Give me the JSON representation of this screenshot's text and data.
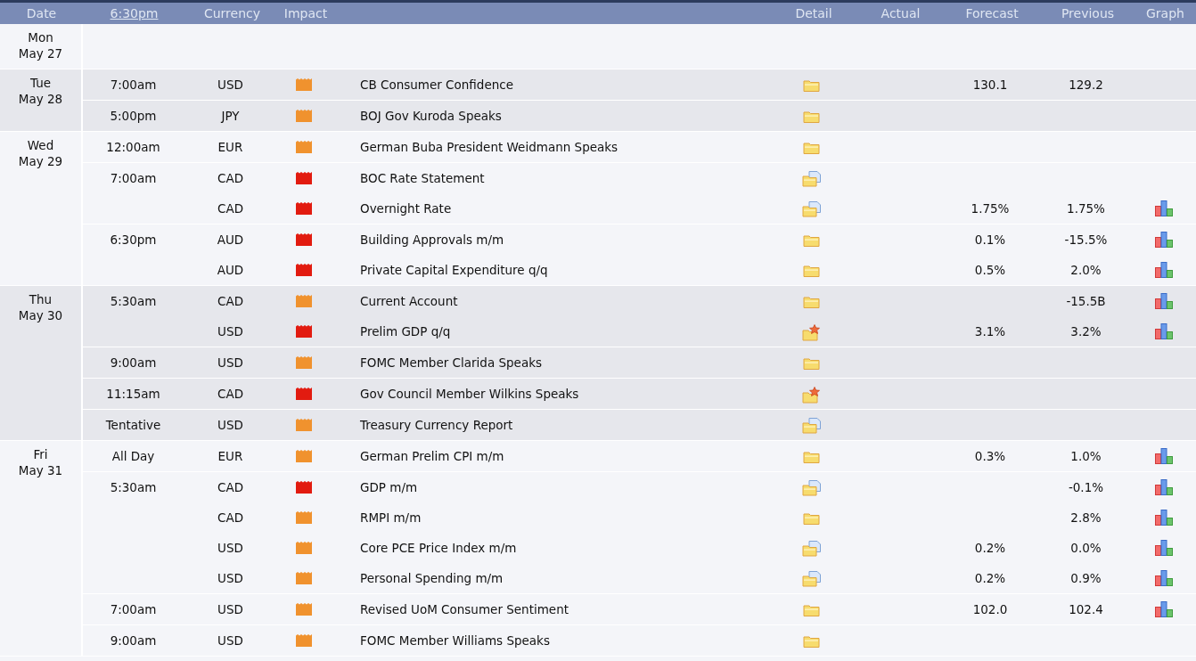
{
  "header": {
    "date": "Date",
    "time": "6:30pm",
    "currency": "Currency",
    "impact": "Impact",
    "detail": "Detail",
    "actual": "Actual",
    "forecast": "Forecast",
    "previous": "Previous",
    "graph": "Graph"
  },
  "days": [
    {
      "day": "Mon",
      "date": "May 27"
    },
    {
      "day": "Tue",
      "date": "May 28",
      "groups": [
        {
          "time": "7:00am",
          "events": [
            {
              "currency": "USD",
              "impact": {
                "color": "#f0922e"
              },
              "title": "CB Consumer Confidence",
              "detail": {
                "kind": "folder"
              },
              "forecast": "130.1",
              "previous": "129.2",
              "graph": false
            }
          ]
        },
        {
          "time": "5:00pm",
          "events": [
            {
              "currency": "JPY",
              "impact": {
                "color": "#f0922e"
              },
              "title": "BOJ Gov Kuroda Speaks",
              "detail": {
                "kind": "folder"
              },
              "graph": false
            }
          ]
        }
      ]
    },
    {
      "day": "Wed",
      "date": "May 29",
      "groups": [
        {
          "time": "12:00am",
          "events": [
            {
              "currency": "EUR",
              "impact": {
                "color": "#f0922e"
              },
              "title": "German Buba President Weidmann Speaks",
              "detail": {
                "kind": "folder"
              },
              "graph": false
            }
          ]
        },
        {
          "time": "7:00am",
          "events": [
            {
              "currency": "CAD",
              "impact": {
                "color": "#e21b10"
              },
              "title": "BOC Rate Statement",
              "detail": {
                "kind": "document"
              },
              "graph": false
            },
            {
              "currency": "CAD",
              "impact": {
                "color": "#e21b10"
              },
              "title": "Overnight Rate",
              "detail": {
                "kind": "document"
              },
              "forecast": "1.75%",
              "previous": "1.75%",
              "graph": true
            }
          ]
        },
        {
          "time": "6:30pm",
          "events": [
            {
              "currency": "AUD",
              "impact": {
                "color": "#e21b10"
              },
              "title": "Building Approvals m/m",
              "detail": {
                "kind": "folder"
              },
              "forecast": "0.1%",
              "previous": "-15.5%",
              "graph": true
            },
            {
              "currency": "AUD",
              "impact": {
                "color": "#e21b10"
              },
              "title": "Private Capital Expenditure q/q",
              "detail": {
                "kind": "folder"
              },
              "forecast": "0.5%",
              "previous": "2.0%",
              "graph": true
            }
          ]
        }
      ]
    },
    {
      "day": "Thu",
      "date": "May 30",
      "groups": [
        {
          "time": "5:30am",
          "events": [
            {
              "currency": "CAD",
              "impact": {
                "color": "#f0922e"
              },
              "title": "Current Account",
              "detail": {
                "kind": "folder"
              },
              "previous": "-15.5B",
              "graph": true
            },
            {
              "currency": "USD",
              "impact": {
                "color": "#e21b10"
              },
              "title": "Prelim GDP q/q",
              "detail": {
                "kind": "star"
              },
              "forecast": "3.1%",
              "previous": "3.2%",
              "graph": true
            }
          ]
        },
        {
          "time": "9:00am",
          "events": [
            {
              "currency": "USD",
              "impact": {
                "color": "#f0922e"
              },
              "title": "FOMC Member Clarida Speaks",
              "detail": {
                "kind": "folder"
              },
              "graph": false
            }
          ]
        },
        {
          "time": "11:15am",
          "events": [
            {
              "currency": "CAD",
              "impact": {
                "color": "#e21b10"
              },
              "title": "Gov Council Member Wilkins Speaks",
              "detail": {
                "kind": "star"
              },
              "graph": false
            }
          ]
        },
        {
          "time": "Tentative",
          "events": [
            {
              "currency": "USD",
              "impact": {
                "color": "#f0922e"
              },
              "title": "Treasury Currency Report",
              "detail": {
                "kind": "document"
              },
              "graph": false
            }
          ]
        }
      ]
    },
    {
      "day": "Fri",
      "date": "May 31",
      "groups": [
        {
          "time": "All Day",
          "events": [
            {
              "currency": "EUR",
              "impact": {
                "color": "#f0922e"
              },
              "title": "German Prelim CPI m/m",
              "detail": {
                "kind": "folder"
              },
              "forecast": "0.3%",
              "previous": "1.0%",
              "graph": true
            }
          ]
        },
        {
          "time": "5:30am",
          "events": [
            {
              "currency": "CAD",
              "impact": {
                "color": "#e21b10"
              },
              "title": "GDP m/m",
              "detail": {
                "kind": "document"
              },
              "previous": "-0.1%",
              "graph": true
            },
            {
              "currency": "CAD",
              "impact": {
                "color": "#f0922e"
              },
              "title": "RMPI m/m",
              "detail": {
                "kind": "folder"
              },
              "previous": "2.8%",
              "graph": true
            },
            {
              "currency": "USD",
              "impact": {
                "color": "#f0922e"
              },
              "title": "Core PCE Price Index m/m",
              "detail": {
                "kind": "document"
              },
              "forecast": "0.2%",
              "previous": "0.0%",
              "graph": true
            },
            {
              "currency": "USD",
              "impact": {
                "color": "#f0922e"
              },
              "title": "Personal Spending m/m",
              "detail": {
                "kind": "document"
              },
              "forecast": "0.2%",
              "previous": "0.9%",
              "graph": true
            }
          ]
        },
        {
          "time": "7:00am",
          "events": [
            {
              "currency": "USD",
              "impact": {
                "color": "#f0922e"
              },
              "title": "Revised UoM Consumer Sentiment",
              "detail": {
                "kind": "folder"
              },
              "forecast": "102.0",
              "previous": "102.4",
              "graph": true
            }
          ]
        },
        {
          "time": "9:00am",
          "events": [
            {
              "currency": "USD",
              "impact": {
                "color": "#f0922e"
              },
              "title": "FOMC Member Williams Speaks",
              "detail": {
                "kind": "folder"
              },
              "graph": false
            }
          ]
        }
      ]
    }
  ]
}
